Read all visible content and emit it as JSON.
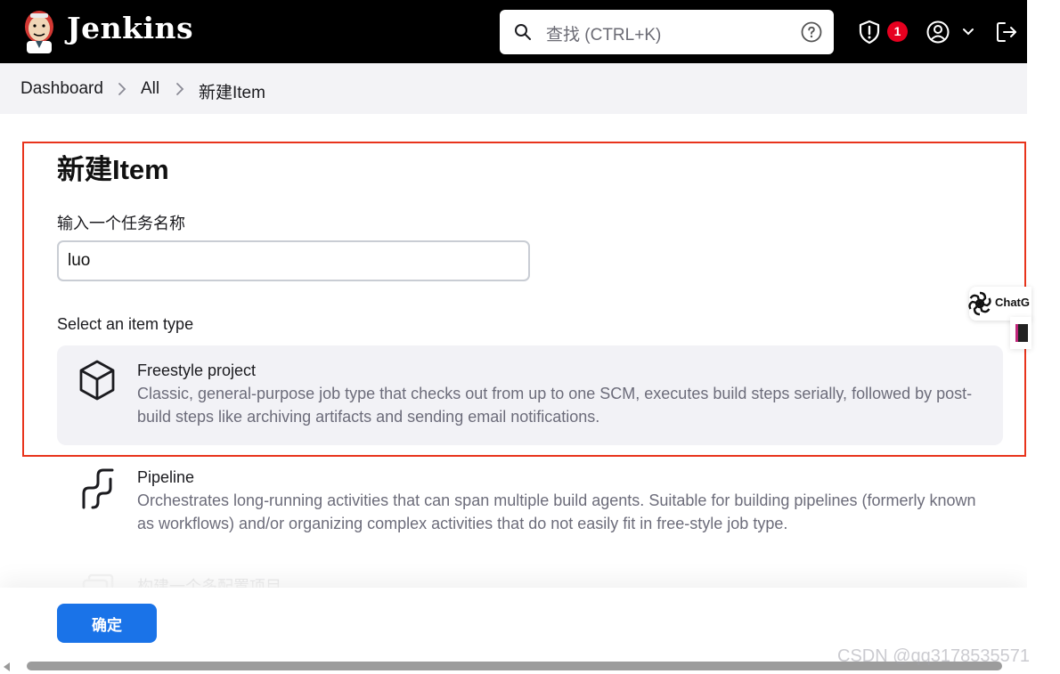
{
  "header": {
    "app_name": "Jenkins",
    "search_placeholder": "查找 (CTRL+K)",
    "notification_count": "1"
  },
  "breadcrumb": [
    {
      "label": "Dashboard"
    },
    {
      "label": "All"
    },
    {
      "label": "新建Item"
    }
  ],
  "page": {
    "title": "新建Item",
    "name_label": "输入一个任务名称",
    "name_value": "luo",
    "type_label": "Select an item type"
  },
  "item_types": [
    {
      "title": "Freestyle project",
      "description": "Classic, general-purpose job type that checks out from up to one SCM, executes build steps serially, followed by post-build steps like archiving artifacts and sending email notifications.",
      "icon": "cube-icon",
      "selected": true
    },
    {
      "title": "Pipeline",
      "description": "Orchestrates long-running activities that can span multiple build agents. Suitable for building pipelines (formerly known as workflows) and/or organizing complex activities that do not easily fit in free-style job type.",
      "icon": "pipeline-icon",
      "selected": false
    },
    {
      "title": "构建一个多配置项目",
      "description": "",
      "icon": "multi-config-icon",
      "selected": false
    }
  ],
  "footer": {
    "ok_label": "确定"
  },
  "side_widget": {
    "label": "ChatG"
  },
  "watermark": "CSDN @qq3178535571",
  "colors": {
    "header_bg": "#000000",
    "primary_button": "#1a73e8",
    "badge": "#e6001f",
    "highlight_border": "#e8341c"
  }
}
